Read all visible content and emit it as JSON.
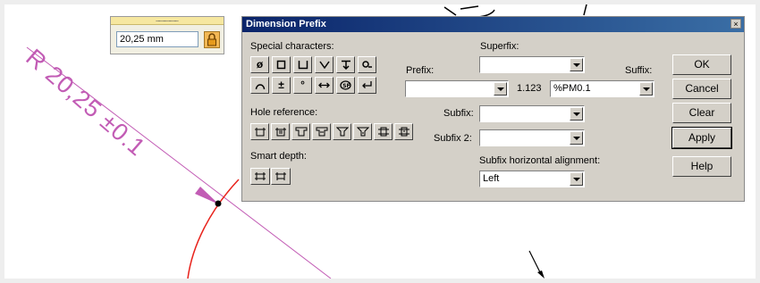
{
  "drawing": {
    "dimension_text": "R 20,25 ±0.1",
    "colors": {
      "dimension": "#c25cb5",
      "arc": "#e8231c",
      "background": "#ffffff"
    }
  },
  "value_box": {
    "grip": "…………………",
    "value": "20,25 mm",
    "lock_icon": "lock-icon"
  },
  "dialog": {
    "title": "Dimension Prefix",
    "close_glyph": "×",
    "special_characters": {
      "label": "Special characters:",
      "row1": [
        "diameter-icon",
        "square-icon",
        "counterbore-icon",
        "countersink-icon",
        "depth-icon",
        "arc-icon"
      ],
      "row2": [
        "arc-length-icon",
        "plus-minus-icon",
        "degree-icon",
        "both-direction-icon",
        "spot-face-icon",
        "return-icon"
      ]
    },
    "hole_reference": {
      "label": "Hole reference:",
      "icons": [
        "hole-simple-icon",
        "hole-thread-icon",
        "hole-counterbore-icon",
        "hole-counterbore-thread-icon",
        "hole-countersink-icon",
        "hole-countersink-thread-icon",
        "hole-tapered-icon",
        "hole-tapered-thread-icon"
      ]
    },
    "smart_depth": {
      "label": "Smart depth:",
      "icons": [
        "depth-thru-icon",
        "depth-blind-icon"
      ]
    },
    "superfix": {
      "label": "Superfix:",
      "value": ""
    },
    "prefix": {
      "label": "Prefix:",
      "value": ""
    },
    "value": "1.123",
    "suffix": {
      "label": "Suffix:",
      "value": "%PM0.1"
    },
    "subfix": {
      "label": "Subfix:",
      "value": ""
    },
    "subfix2": {
      "label": "Subfix 2:",
      "value": ""
    },
    "alignment": {
      "label": "Subfix horizontal alignment:",
      "value": "Left"
    },
    "buttons": {
      "ok": "OK",
      "cancel": "Cancel",
      "clear": "Clear",
      "apply": "Apply",
      "help": "Help"
    }
  }
}
